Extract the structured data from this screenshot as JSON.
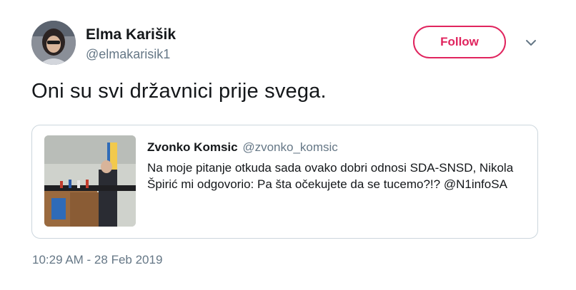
{
  "author": {
    "display_name": "Elma Karišik",
    "username": "@elmakarisik1"
  },
  "actions": {
    "follow_label": "Follow",
    "follow_color": "#e0245e"
  },
  "tweet": {
    "text": "Oni su svi državnici prije svega.",
    "timestamp": "10:29 AM - 28 Feb 2019"
  },
  "quoted_tweet": {
    "display_name": "Zvonko Komsic",
    "username": "@zvonko_komsic",
    "text_lines": [
      "Na moje pitanje otkuda sada ovako dobri odnosi SDA-SNSD, Nikola",
      "Špirić mi odgovorio: Pa šta očekujete da se tucemo?!? @N1infoSA"
    ]
  },
  "icons": {
    "more_menu": "chevron-down-icon"
  }
}
